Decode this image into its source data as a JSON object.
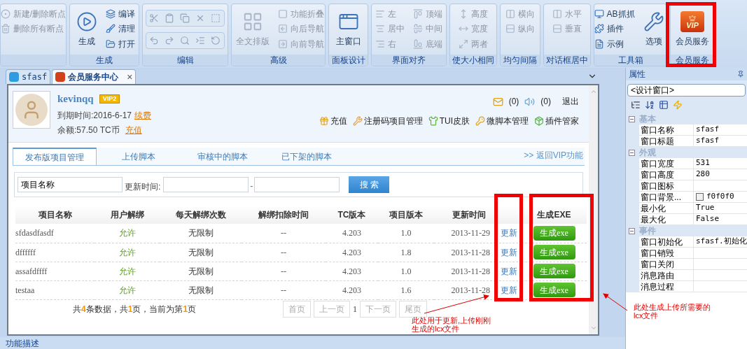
{
  "ribbon": {
    "groups": [
      {
        "kind": "items",
        "items": [
          {
            "label": "新建/删除断点",
            "kind": "small",
            "disabled": true
          },
          {
            "label": "删除所有断点",
            "kind": "small",
            "disabled": true
          }
        ]
      },
      {
        "kind": "items",
        "label": "生成",
        "items": [
          {
            "label": "生成",
            "kind": "large",
            "disabled": false
          },
          {
            "label": "编译",
            "kind": "small",
            "disabled": false
          },
          {
            "label": "清理",
            "kind": "small",
            "disabled": false
          },
          {
            "label": "打开",
            "kind": "small",
            "disabled": false
          }
        ]
      },
      {
        "kind": "icon_grid",
        "label": "编辑"
      },
      {
        "kind": "items",
        "label": "高级",
        "items": [
          {
            "label": "全文排版",
            "kind": "large",
            "disabled": true
          },
          {
            "label": "功能折叠",
            "kind": "small",
            "disabled": true
          },
          {
            "label": "向后导航",
            "kind": "small",
            "disabled": true
          },
          {
            "label": "向前导航",
            "kind": "small",
            "disabled": true
          }
        ]
      },
      {
        "kind": "items",
        "label": "面板设计",
        "items": [
          {
            "label": "主窗口",
            "kind": "large",
            "disabled": false
          }
        ]
      },
      {
        "kind": "items",
        "label": "界面对齐",
        "items": [
          {
            "label": "左",
            "kind": "small",
            "disabled": true
          },
          {
            "label": "居中",
            "kind": "small",
            "disabled": true
          },
          {
            "label": "右",
            "kind": "small",
            "disabled": true
          },
          {
            "label": "顶端",
            "kind": "small",
            "disabled": true
          },
          {
            "label": "中间",
            "kind": "small",
            "disabled": true
          },
          {
            "label": "底端",
            "kind": "small",
            "disabled": true
          }
        ]
      },
      {
        "kind": "items",
        "label": "使大小相同",
        "items": [
          {
            "label": "高度",
            "kind": "small",
            "disabled": true
          },
          {
            "label": "宽度",
            "kind": "small",
            "disabled": true
          },
          {
            "label": "两者",
            "kind": "small",
            "disabled": true
          }
        ]
      },
      {
        "kind": "items",
        "label": "均匀间隔",
        "items": [
          {
            "label": "横向",
            "kind": "small",
            "disabled": true
          },
          {
            "label": "纵向",
            "kind": "small",
            "disabled": true
          }
        ]
      },
      {
        "kind": "items",
        "label": "对话框居中",
        "items": [
          {
            "label": "水平",
            "kind": "small",
            "disabled": true
          },
          {
            "label": "垂直",
            "kind": "small",
            "disabled": true
          }
        ]
      },
      {
        "kind": "items",
        "label": "工具箱",
        "items": [
          {
            "label": "AB抓抓",
            "kind": "small",
            "disabled": false
          },
          {
            "label": "插件",
            "kind": "small",
            "disabled": false
          },
          {
            "label": "示例",
            "kind": "small",
            "disabled": false
          },
          {
            "label": "选项",
            "kind": "large",
            "disabled": false
          }
        ]
      },
      {
        "kind": "items",
        "label": "会员服务",
        "items": [
          {
            "label": "会员服务",
            "kind": "large",
            "disabled": false,
            "icon_text": "VIP"
          }
        ]
      }
    ]
  },
  "doc_tabs": [
    {
      "label": "sfasf",
      "selected": false
    },
    {
      "label": "会员服务中心",
      "selected": true,
      "close": "×"
    }
  ],
  "member": {
    "username": "kevinqq",
    "badge": "VIP2",
    "expiry": "到期时间:2016-6-17",
    "renew_link": "续费",
    "balance": "余额:57.50 TC币",
    "recharge_link": "充值",
    "messages": "(0)",
    "notices": "(0)",
    "logout": "退出",
    "links": [
      "充值",
      "注册码项目管理",
      "TUI皮肤",
      "微脚本管理",
      "插件管家"
    ]
  },
  "tabs": [
    {
      "label": "发布版项目管理",
      "selected": true
    },
    {
      "label": "上传脚本",
      "selected": false
    },
    {
      "label": "审核中的脚本",
      "selected": false
    },
    {
      "label": "已下架的脚本",
      "selected": false
    }
  ],
  "back_link": ">> 返回VIP功能",
  "search": {
    "name_value": "项目名称",
    "time_label": "更新时间:",
    "separator": "-",
    "button": "搜 索"
  },
  "table": {
    "columns": [
      "项目名称",
      "用户解绑",
      "每天解绑次数",
      "解绑扣除时间",
      "TC版本",
      "项目版本",
      "更新时间",
      "生成EXE"
    ],
    "rows": [
      {
        "cells": [
          "sfdasdfasdf",
          "允许",
          "无限制",
          "--",
          "4.203",
          "1.0",
          "2013-11-29"
        ],
        "link": "更新",
        "button": "生成exe"
      },
      {
        "cells": [
          "dffffff",
          "允许",
          "无限制",
          "--",
          "4.203",
          "1.8",
          "2013-11-28"
        ],
        "link": "更新",
        "button": "生成exe"
      },
      {
        "cells": [
          "assafdffff",
          "允许",
          "无限制",
          "--",
          "4.203",
          "1.0",
          "2013-11-28"
        ],
        "link": "更新",
        "button": "生成exe"
      },
      {
        "cells": [
          "testaa",
          "允许",
          "无限制",
          "--",
          "4.203",
          "1.6",
          "2013-11-28"
        ],
        "link": "更新",
        "button": "生成exe"
      }
    ]
  },
  "pager": {
    "summary": "共**4**条数据，共**1**页，当前为第**1**页",
    "items": [
      {
        "label": "首页",
        "kind": "button",
        "disabled": true
      },
      {
        "label": "上一页",
        "kind": "button",
        "disabled": true
      },
      {
        "label": "1",
        "kind": "current"
      },
      {
        "label": "下一页",
        "kind": "button",
        "disabled": true
      },
      {
        "label": "尾页",
        "kind": "button",
        "disabled": true
      }
    ]
  },
  "annotations": [
    {
      "lines": [
        "此处用于更新,上传刚刚",
        "生成的lcx文件"
      ]
    },
    {
      "lines": [
        "此处生成上传所需要的",
        "lcx文件"
      ]
    }
  ],
  "properties": {
    "title": "属性",
    "object": "<设计窗口>",
    "categories": [
      {
        "name": "基本",
        "expanded": true,
        "items": [
          {
            "name": "窗口名称",
            "value": "sfasf"
          },
          {
            "name": "窗口标题",
            "value": "sfasf"
          }
        ]
      },
      {
        "name": "外观",
        "expanded": true,
        "items": [
          {
            "name": "窗口宽度",
            "value": "531"
          },
          {
            "name": "窗口高度",
            "value": "280"
          },
          {
            "name": "窗口图标"
          },
          {
            "name": "窗口背景...",
            "value": "f0f0f0",
            "kind": "color"
          },
          {
            "name": "最小化",
            "value": "True"
          },
          {
            "name": "最大化",
            "value": "False"
          }
        ]
      },
      {
        "name": "事件",
        "expanded": true,
        "items": [
          {
            "name": "窗口初始化",
            "value": "sfasf.初始化"
          },
          {
            "name": "窗口销毁"
          },
          {
            "name": "窗口关闭"
          },
          {
            "name": "消息路由"
          },
          {
            "name": "消息过程"
          }
        ]
      }
    ]
  },
  "bottom_panel": {
    "title": "功能描述"
  }
}
